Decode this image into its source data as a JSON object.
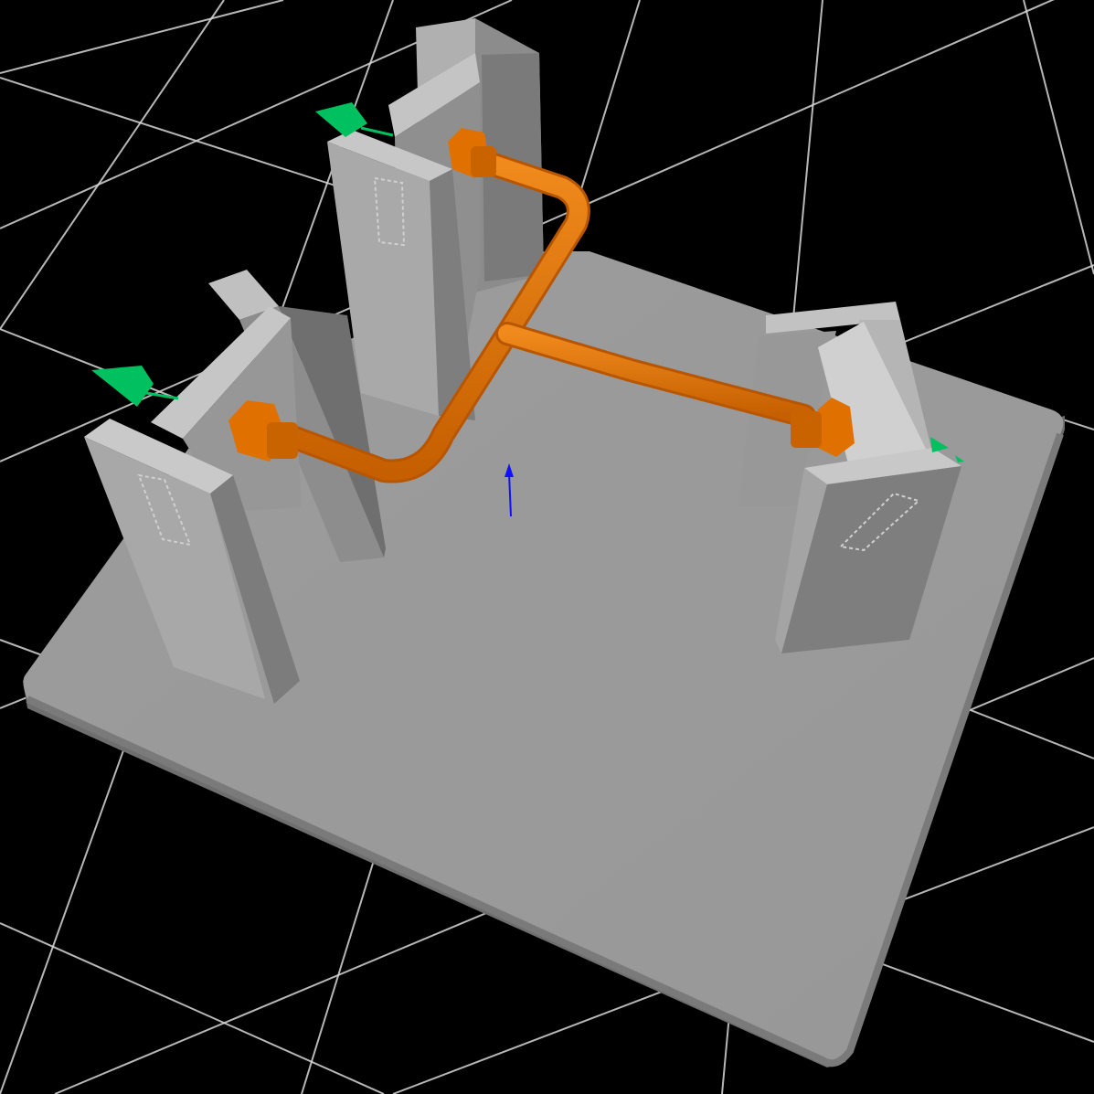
{
  "viewport": {
    "background": "#000000",
    "grid_color": "#d8d8d8",
    "plate_color": "#9a9a9a",
    "bracket_color": "#a6a6a6",
    "pipe_color": "#e07000",
    "port_marker_color": "#00c060",
    "up_axis_color": "#1010ff"
  },
  "scene": {
    "objects": [
      {
        "name": "base-plate",
        "kind": "plate"
      },
      {
        "name": "support-bracket-left",
        "kind": "bracket"
      },
      {
        "name": "support-bracket-top",
        "kind": "bracket"
      },
      {
        "name": "support-bracket-right",
        "kind": "bracket"
      },
      {
        "name": "orange-pipe-assembly",
        "kind": "pipe",
        "branches": 3
      },
      {
        "name": "pipe-fitting-left",
        "kind": "hex-fitting"
      },
      {
        "name": "pipe-fitting-top",
        "kind": "hex-fitting"
      },
      {
        "name": "pipe-fitting-right",
        "kind": "hex-fitting"
      },
      {
        "name": "port-marker-left",
        "kind": "direction-arrow"
      },
      {
        "name": "port-marker-top",
        "kind": "direction-arrow"
      },
      {
        "name": "port-marker-right",
        "kind": "direction-arrow"
      },
      {
        "name": "up-axis-indicator",
        "kind": "axis-arrow"
      }
    ]
  }
}
